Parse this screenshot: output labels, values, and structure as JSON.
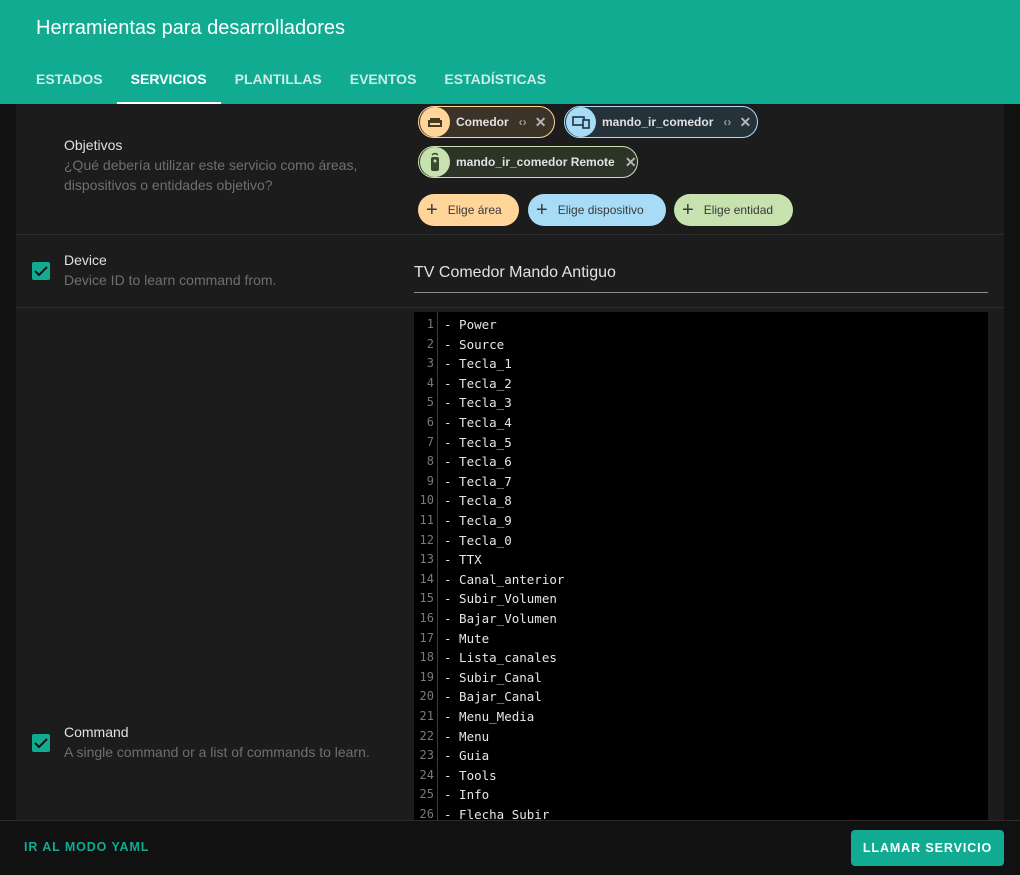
{
  "header": {
    "title": "Herramientas para desarrolladores",
    "tabs": [
      {
        "label": "ESTADOS"
      },
      {
        "label": "SERVICIOS"
      },
      {
        "label": "PLANTILLAS"
      },
      {
        "label": "EVENTOS"
      },
      {
        "label": "ESTADÍSTICAS"
      }
    ]
  },
  "targets": {
    "title": "Objetivos",
    "description": "¿Qué debería utilizar este servicio como áreas, dispositivos o entidades objetivo?",
    "chips": [
      {
        "label": "Comedor",
        "icon": "sofa-icon"
      },
      {
        "label": "mando_ir_comedor",
        "icon": "devices-icon"
      },
      {
        "label": "mando_ir_comedor Remote",
        "icon": "remote-icon"
      }
    ],
    "add_area": "Elige área",
    "add_device": "Elige dispositivo",
    "add_entity": "Elige entidad"
  },
  "device": {
    "title": "Device",
    "description": "Device ID to learn command from.",
    "value": "TV Comedor Mando Antiguo"
  },
  "command": {
    "title": "Command",
    "description": "A single command or a list of commands to learn.",
    "lines": [
      {
        "n": "1",
        "text": "- Power"
      },
      {
        "n": "2",
        "text": "- Source"
      },
      {
        "n": "3",
        "text": "- Tecla_1"
      },
      {
        "n": "4",
        "text": "- Tecla_2"
      },
      {
        "n": "5",
        "text": "- Tecla_3"
      },
      {
        "n": "6",
        "text": "- Tecla_4"
      },
      {
        "n": "7",
        "text": "- Tecla_5"
      },
      {
        "n": "8",
        "text": "- Tecla_6"
      },
      {
        "n": "9",
        "text": "- Tecla_7"
      },
      {
        "n": "10",
        "text": "- Tecla_8"
      },
      {
        "n": "11",
        "text": "- Tecla_9"
      },
      {
        "n": "12",
        "text": "- Tecla_0"
      },
      {
        "n": "13",
        "text": "- TTX"
      },
      {
        "n": "14",
        "text": "- Canal_anterior"
      },
      {
        "n": "15",
        "text": "- Subir_Volumen"
      },
      {
        "n": "16",
        "text": "- Bajar_Volumen"
      },
      {
        "n": "17",
        "text": "- Mute"
      },
      {
        "n": "18",
        "text": "- Lista_canales"
      },
      {
        "n": "19",
        "text": "- Subir_Canal"
      },
      {
        "n": "20",
        "text": "- Bajar_Canal"
      },
      {
        "n": "21",
        "text": "- Menu_Media"
      },
      {
        "n": "22",
        "text": "- Menu"
      },
      {
        "n": "23",
        "text": "- Guia"
      },
      {
        "n": "24",
        "text": "- Tools"
      },
      {
        "n": "25",
        "text": "- Info"
      },
      {
        "n": "26",
        "text": "- Flecha_Subir"
      }
    ]
  },
  "footer": {
    "yaml_mode": "IR AL MODO YAML",
    "call_service": "LLAMAR SERVICIO"
  },
  "colors": {
    "accent": "#11ab92",
    "area_chip": "#ffd59a",
    "device_chip": "#a8dcf6",
    "entity_chip": "#c7e2ae"
  }
}
